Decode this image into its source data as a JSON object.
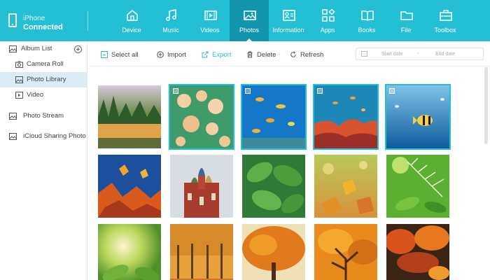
{
  "device": {
    "name": "iPhone",
    "status": "Connected"
  },
  "nav": [
    {
      "label": "Device",
      "icon": "home-icon",
      "active": false
    },
    {
      "label": "Music",
      "icon": "music-icon",
      "active": false
    },
    {
      "label": "Videos",
      "icon": "video-icon",
      "active": false
    },
    {
      "label": "Photos",
      "icon": "photo-icon",
      "active": true
    },
    {
      "label": "Information",
      "icon": "contact-card-icon",
      "active": false
    },
    {
      "label": "Apps",
      "icon": "apps-icon",
      "active": false
    },
    {
      "label": "Books",
      "icon": "book-icon",
      "active": false
    },
    {
      "label": "File",
      "icon": "folder-icon",
      "active": false
    },
    {
      "label": "Toolbox",
      "icon": "toolbox-icon",
      "active": false
    }
  ],
  "sidebar": {
    "album_list": "Album List",
    "items": [
      {
        "label": "Camera Roll",
        "icon": "camera-icon",
        "active": false
      },
      {
        "label": "Photo Library",
        "icon": "image-icon",
        "active": true
      },
      {
        "label": "Video",
        "icon": "play-icon",
        "active": false
      }
    ],
    "photo_stream": "Photo Stream",
    "icloud": "iCloud Sharing Photo"
  },
  "toolbar": {
    "select_all": "Select all",
    "import": "Import",
    "export": "Export",
    "delete": "Delete",
    "refresh": "Refresh",
    "start_date": "Start date",
    "date_sep": "-",
    "end_date": "End date"
  },
  "colors": {
    "accent": "#25bfd5",
    "active_nav": "#1396ad",
    "sidebar_active": "#dcecf7"
  },
  "photos": [
    {
      "name": "forest-lake",
      "selected": false
    },
    {
      "name": "jellyfish",
      "selected": true
    },
    {
      "name": "tropical-fish",
      "selected": true
    },
    {
      "name": "coral-reef",
      "selected": true
    },
    {
      "name": "blue-fish",
      "selected": true
    },
    {
      "name": "autumn-leaves-blue-sky",
      "selected": false
    },
    {
      "name": "onion-dome-church",
      "selected": false
    },
    {
      "name": "green-leaves",
      "selected": false
    },
    {
      "name": "yellow-leaves-bokeh",
      "selected": false
    },
    {
      "name": "green-leaves-sunlight",
      "selected": false
    },
    {
      "name": "green-leaves-sun",
      "selected": false
    },
    {
      "name": "autumn-trees-row",
      "selected": false
    },
    {
      "name": "orange-tree",
      "selected": false
    },
    {
      "name": "orange-tree-branches",
      "selected": false
    },
    {
      "name": "autumn-forest",
      "selected": false
    }
  ]
}
